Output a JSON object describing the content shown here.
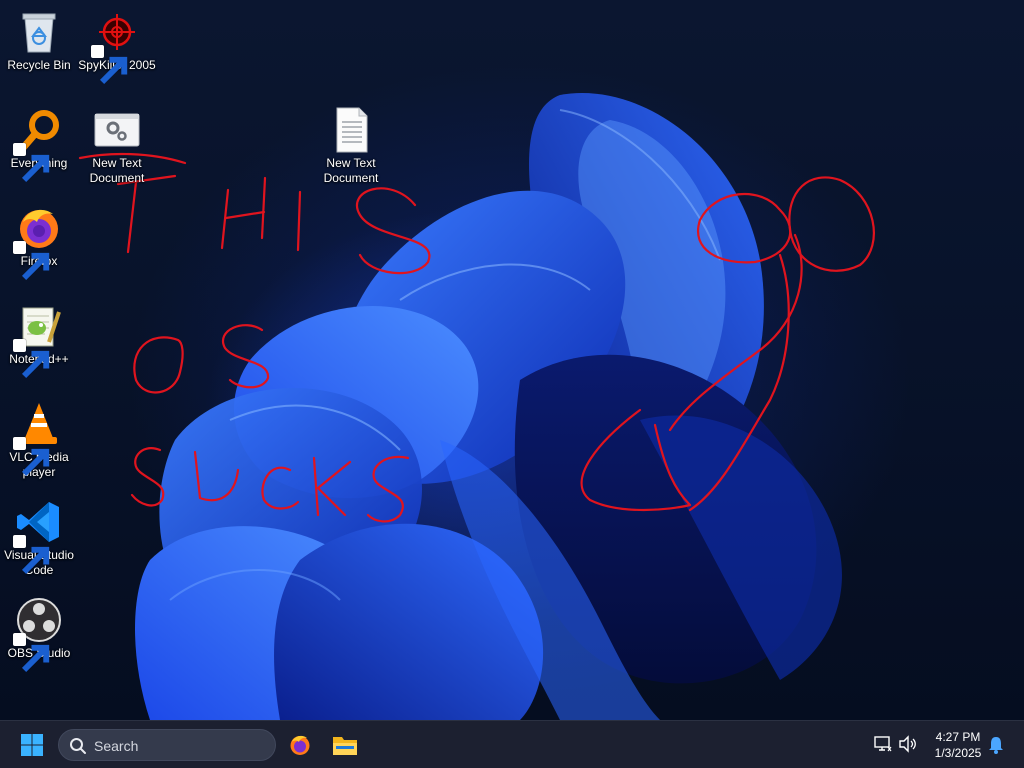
{
  "desktop": {
    "icons": [
      {
        "label": "Recycle Bin",
        "icon": "recycle-bin-icon",
        "shortcut": false
      },
      {
        "label": "SpyKiller 2005",
        "icon": "spykiller-icon",
        "shortcut": true
      },
      {
        "label": "Everything",
        "icon": "everything-icon",
        "shortcut": true
      },
      {
        "label": "New Text Document",
        "icon": "settings-file-icon",
        "shortcut": false
      },
      {
        "label": "New Text Document",
        "icon": "text-file-icon",
        "shortcut": false
      },
      {
        "label": "Firefox",
        "icon": "firefox-icon",
        "shortcut": true
      },
      {
        "label": "Notepad++",
        "icon": "notepadpp-icon",
        "shortcut": true
      },
      {
        "label": "VLC media player",
        "icon": "vlc-icon",
        "shortcut": true
      },
      {
        "label": "Visual Studio Code",
        "icon": "vscode-icon",
        "shortcut": true
      },
      {
        "label": "OBS Studio",
        "icon": "obs-icon",
        "shortcut": true
      }
    ],
    "scribble_color": "#e0141e"
  },
  "taskbar": {
    "search_label": "Search",
    "pinned": [
      "start-icon",
      "firefox-icon",
      "file-explorer-icon"
    ],
    "clock": {
      "time": "4:27 PM",
      "date": "1/3/2025"
    },
    "accent": "#1e90ff"
  }
}
